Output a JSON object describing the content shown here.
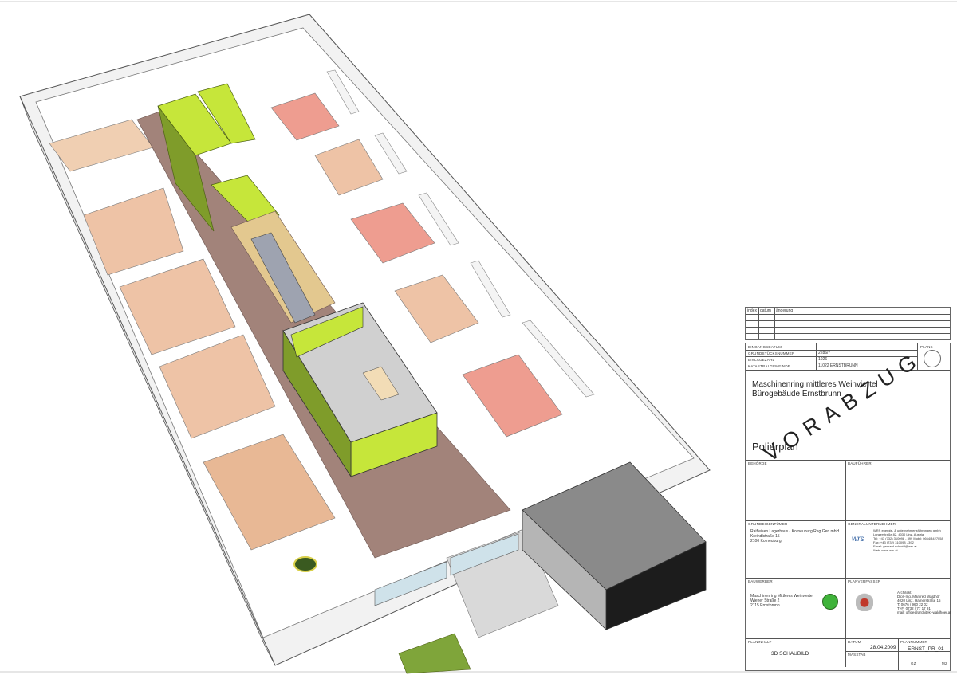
{
  "revision_table": {
    "headers": [
      "index",
      "datum",
      "änderung"
    ]
  },
  "title_block": {
    "parcel_labels": [
      "EINGANGSDATUM",
      "GRUNDSTÜCKSNUMMER",
      "EINLAGEZAHL",
      "KATASTRALGEMEINDE"
    ],
    "parcel_values": [
      "",
      "2286/7",
      "1026",
      "11022  ERNSTBRUNN"
    ],
    "north_label": "PLANS",
    "project_line1": "Maschinenring mittleres Weinviertel",
    "project_line2": "Bürogebäude Ernstbrunn",
    "plan_type": "Polierplan",
    "stamp": "VORABZUG",
    "behoerde_label": "BEHÖRDE",
    "bauf_label": "BAUFÜHRER",
    "owner_label": "GRUNDEIGENTÜMER",
    "owner_lines": [
      "Raiffeisen Lagerhaus - Korneuburg Reg.Gen.mbH",
      "Kreindlstraße 15",
      "2100 Korneuburg"
    ],
    "gc_label": "GENERALUNTERNEHMER",
    "gc_logo": "wrs",
    "gc_lines": [
      "WRS energie- & unternehmensführungen gmbh",
      "Lunzerstraße 82, 4030 Linz, Austria",
      "Tel:   +43 (732) 310098 - 399 Mobil: 0664/3427058",
      "Fax:   +43 (732) 310098 - 392",
      "Email: gerhard.schmid@wrs.at",
      "Web:   www.wrs.at"
    ],
    "client_label": "BAUWERBER",
    "client_lines": [
      "Maschinenring Mittleres Weinviertel",
      "Wiener Straße 2",
      "2115 Ernstbrunn"
    ],
    "planner_label": "PLANVERFASSER",
    "planner_lines": [
      "Architekt",
      "Dipl.-Ing. Manfred Waldhör",
      "4020 Linz, Hamerstraße 15",
      "T: 0676 / 960 22 02",
      "T+F: 0732 / 77 17 91",
      "mail: office@architekt-waldhoer.at"
    ],
    "content_label": "PLANINHALT",
    "content": "3D SCHAUBILD",
    "date_label": "DATUM",
    "date": "28.04.2009",
    "planno_label": "PLANNUMMER",
    "planno": "ERNST_PR_01",
    "scale_label": "MASSTAB",
    "gz_label": "GZ",
    "m2_label": "m2"
  },
  "colors": {
    "green": "#c6e63a",
    "green_dark": "#7f9c2a",
    "floor_brown": "#a2837a",
    "office_floor": "#eec3a6",
    "pink_floor": "#ee9d90",
    "desk": "#f2dcb6",
    "gray_block": "#8a8a8a"
  }
}
